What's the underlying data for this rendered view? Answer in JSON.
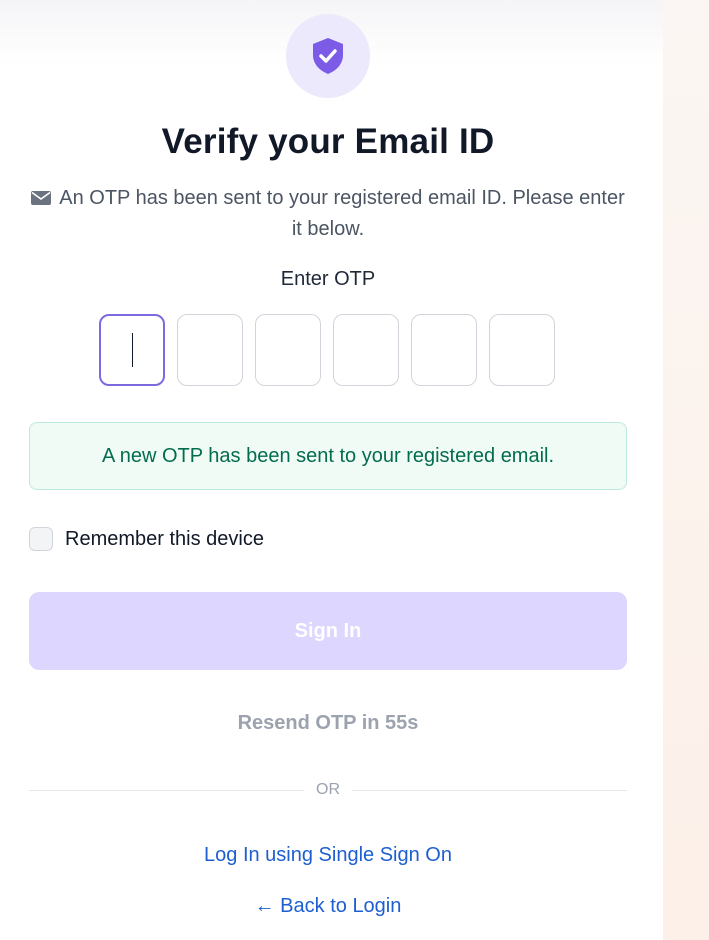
{
  "header": {
    "icon": "shield-check-icon",
    "title": "Verify your Email ID",
    "subtitle_icon": "mail-icon",
    "subtitle": "An OTP has been sent to your registered email ID. Please enter it below."
  },
  "otp": {
    "label": "Enter OTP",
    "digits": [
      "",
      "",
      "",
      "",
      "",
      ""
    ]
  },
  "notice": {
    "text": "A new OTP has been sent to your registered email."
  },
  "remember": {
    "label": "Remember this device"
  },
  "actions": {
    "signin_label": "Sign In",
    "resend_text": "Resend OTP in 55s",
    "divider_text": "OR",
    "sso_label": "Log In using Single Sign On",
    "back_label": "← Back to Login"
  },
  "colors": {
    "accent": "#7c6ae0",
    "signin_disabled": "#ddd6fe",
    "success_text": "#046c4e",
    "link": "#1d5fd1"
  }
}
